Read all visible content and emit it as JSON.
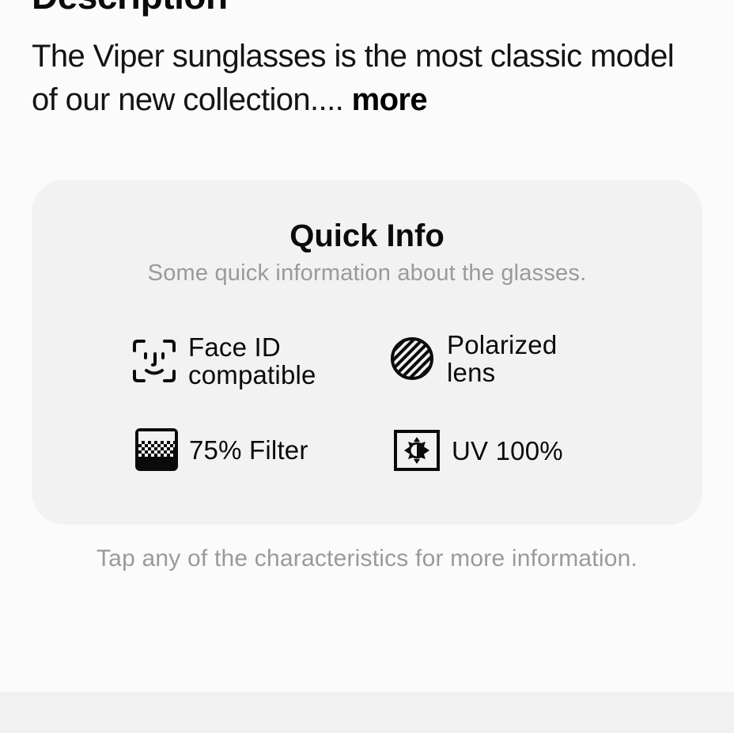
{
  "description": {
    "heading": "Description",
    "text": "The Viper sunglasses is the most classic model of our new collection.... ",
    "more_label": "more"
  },
  "quick_info": {
    "title": "Quick Info",
    "subtitle": "Some quick information about the glasses.",
    "features": [
      {
        "label": "Face ID\ncompatible",
        "icon": "face-id-icon"
      },
      {
        "label": "Polarized\nlens",
        "icon": "polarized-lens-icon"
      },
      {
        "label": "75% Filter",
        "icon": "filter-icon"
      },
      {
        "label": "UV 100%",
        "icon": "uv-protection-icon"
      }
    ]
  },
  "footer_note": "Tap any of the characteristics for more information.",
  "colors": {
    "background": "#fbfbfb",
    "card": "#f2f2f2",
    "muted_text": "#9a9a9a",
    "bottom_bar": "#f1f1f1"
  }
}
